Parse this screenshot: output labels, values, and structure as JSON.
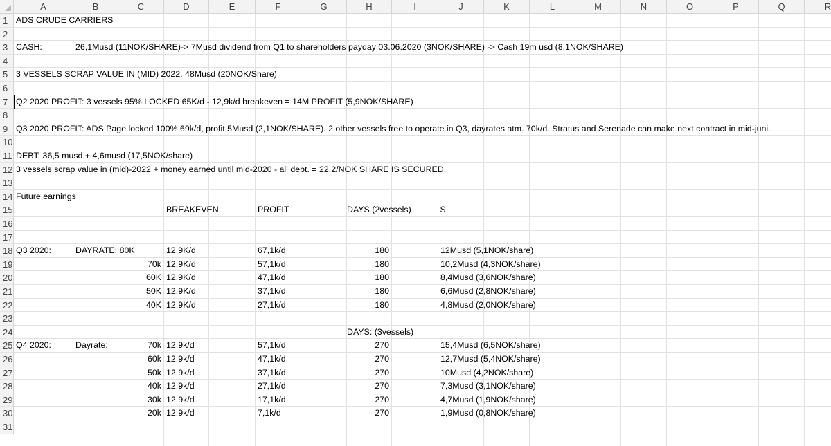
{
  "columns": [
    "A",
    "B",
    "C",
    "D",
    "E",
    "F",
    "G",
    "H",
    "I",
    "J",
    "K",
    "L",
    "M",
    "N",
    "O",
    "P",
    "Q",
    "R"
  ],
  "rows": [
    "1",
    "2",
    "3",
    "4",
    "5",
    "6",
    "7",
    "8",
    "9",
    "10",
    "11",
    "12",
    "13",
    "14",
    "15",
    "16",
    "17",
    "18",
    "19",
    "20",
    "21",
    "22",
    "23",
    "24",
    "25",
    "26",
    "27",
    "28",
    "29",
    "30",
    "31"
  ],
  "cells": {
    "r1": {
      "a": "ADS CRUDE CARRIERS"
    },
    "r3": {
      "a": "CASH:",
      "b": "26,1Musd (11NOK/SHARE)-> 7Musd dividend from Q1 to shareholders payday 03.06.2020 (3NOK/SHARE) -> Cash 19m usd (8,1NOK/SHARE)"
    },
    "r5": {
      "a": " 3 VESSELS SCRAP VALUE IN (MID) 2022. 48Musd (20NOK/Share)"
    },
    "r7": {
      "a": "Q2 2020 PROFIT: 3 vessels 95% LOCKED 65K/d - 12,9k/d breakeven = 14M PROFIT (5,9NOK/SHARE)"
    },
    "r9": {
      "a": "Q3 2020 PROFIT: ADS Page locked 100% 69k/d, profit 5Musd (2,1NOK/SHARE). 2 other vessels free to operate in Q3, dayrates atm. 70k/d. Stratus and Serenade can make next contract in mid-juni."
    },
    "r11": {
      "a": "DEBT: 36,5 musd + 4,6musd (17,5NOK/share)"
    },
    "r12": {
      "a": "3 vessels scrap value in (mid)-2022 + money earned until mid-2020 - all debt. = 22,2/NOK SHARE IS SECURED."
    },
    "r14": {
      "a": "Future earnings"
    },
    "r15": {
      "d": "BREAKEVEN",
      "f": "PROFIT",
      "h": "DAYS (2vessels)",
      "j": "$"
    },
    "r18": {
      "a": "Q3 2020:",
      "b": "DAYRATE: 80K",
      "d": "12,9K/d",
      "f": "67,1k/d",
      "h": "180",
      "j": "12Musd (5,1NOK/share)"
    },
    "r19": {
      "c": "70k",
      "d": "12,9K/d",
      "f": "57,1k/d",
      "h": "180",
      "j": "10,2Musd (4,3NOK/share)"
    },
    "r20": {
      "c": "60K",
      "d": "12,9K/d",
      "f": "47,1k/d",
      "h": "180",
      "j": "8,4Musd (3,6NOK/share)"
    },
    "r21": {
      "c": "50K",
      "d": "12,9K/d",
      "f": "37,1k/d",
      "h": "180",
      "j": "6,6Musd (2,8NOK/share)"
    },
    "r22": {
      "c": "40K",
      "d": "12,9K/d",
      "f": "27,1k/d",
      "h": "180",
      "j": "4,8Musd (2,0NOK/share)"
    },
    "r24": {
      "h": "DAYS: (3vessels)"
    },
    "r25": {
      "a": "Q4 2020:",
      "b": "Dayrate:",
      "c": "70k",
      "d": "12,9k/d",
      "f": "57,1k/d",
      "h": "270",
      "j": "15,4Musd (6,5NOK/share)"
    },
    "r26": {
      "c": "60k",
      "d": "12,9k/d",
      "f": "47,1k/d",
      "h": "270",
      "j": "12,7Musd (5,4NOK/share)"
    },
    "r27": {
      "c": "50k",
      "d": "12,9k/d",
      "f": "37,1k/d",
      "h": "270",
      "j": "10Musd (4,2NOK/share)"
    },
    "r28": {
      "c": "40k",
      "d": "12,9k/d",
      "f": "27,1k/d",
      "h": "270",
      "j": "7,3Musd (3,1NOK/share)"
    },
    "r29": {
      "c": "30k",
      "d": "12,9k/d",
      "f": "17,1k/d",
      "h": "270",
      "j": "4,7Musd (1,9NOK/share)"
    },
    "r30": {
      "c": "20k",
      "d": "12,9k/d",
      "f": "7,1k/d",
      "h": "270",
      "j": "1,9Musd (0,8NOK/share)"
    }
  },
  "colors": {
    "header_bg": "#f3f3f3",
    "gridline": "#e1e1e1",
    "text": "#000000"
  }
}
